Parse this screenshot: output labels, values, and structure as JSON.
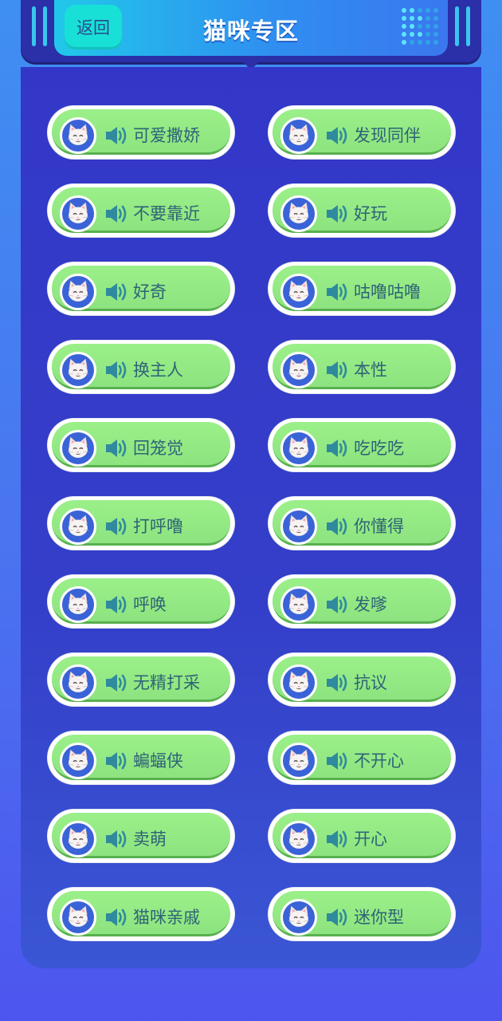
{
  "header": {
    "back_label": "返回",
    "title": "猫咪专区"
  },
  "colors": {
    "button_green": "#92e882",
    "label_text": "#2e6377",
    "panel_blue": "#3337c8",
    "back_button": "#18e0d6"
  },
  "sounds": {
    "left": [
      "可爱撒娇",
      "不要靠近",
      "好奇",
      "换主人",
      "回笼觉",
      "打呼噜",
      "呼唤",
      "无精打采",
      "蝙蝠侠",
      "卖萌",
      "猫咪亲戚"
    ],
    "right": [
      "发现同伴",
      "好玩",
      "咕噜咕噜",
      "本性",
      "吃吃吃",
      "你懂得",
      "发嗲",
      "抗议",
      "不开心",
      "开心",
      "迷你型"
    ]
  },
  "icons": {
    "avatar": "cat-face-icon",
    "play": "speaker-icon"
  }
}
